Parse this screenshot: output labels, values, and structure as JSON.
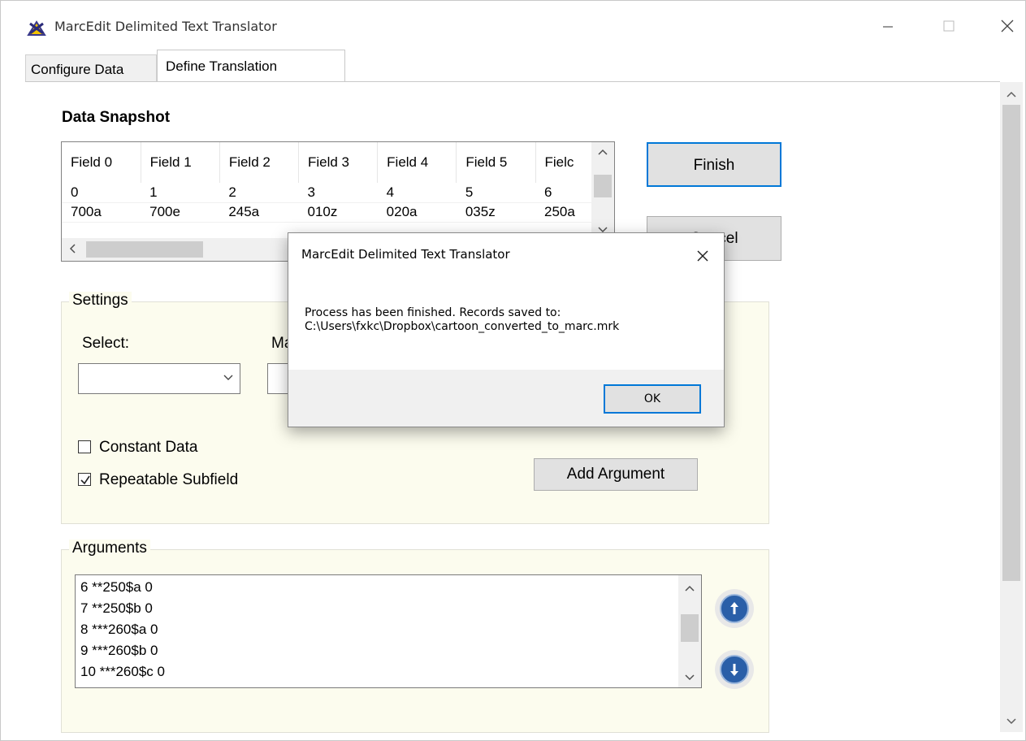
{
  "window": {
    "title": "MarcEdit Delimited Text Translator",
    "icons": {
      "app": "marcedit-app-icon",
      "minimize": "minimize-icon",
      "maximize": "maximize-icon",
      "close": "close-icon"
    }
  },
  "tabs": [
    {
      "label": "Configure Data",
      "active": false
    },
    {
      "label": "Define Translation",
      "active": true
    }
  ],
  "snapshot": {
    "title": "Data Snapshot",
    "headers": [
      "Field 0",
      "Field 1",
      "Field 2",
      "Field 3",
      "Field 4",
      "Field 5",
      "Fielc"
    ],
    "rows": [
      [
        "0",
        "1",
        "2",
        "3",
        "4",
        "5",
        "6"
      ],
      [
        "700a",
        "700e",
        "245a",
        "010z",
        "020a",
        "035z",
        "250a"
      ]
    ]
  },
  "buttons": {
    "finish": "Finish",
    "cancel": "Cancel",
    "add_argument": "Add Argument"
  },
  "settings": {
    "group_label": "Settings",
    "select_label": "Select:",
    "map_label": "Ma",
    "select_value": "",
    "constant_data": {
      "label": "Constant Data",
      "checked": false
    },
    "repeatable_subfield": {
      "label": "Repeatable Subfield",
      "checked": true
    }
  },
  "arguments": {
    "group_label": "Arguments",
    "items": [
      "6 **250$a 0",
      "7 **250$b 0",
      "8 ***260$a 0",
      "9 ***260$b 0",
      "10 ***260$c 0"
    ],
    "icons": {
      "up": "arrow-up-icon",
      "down": "arrow-down-icon"
    }
  },
  "dialog": {
    "title": "MarcEdit Delimited Text Translator",
    "message_line1": "Process has been finished.  Records saved to:",
    "message_line2": "C:\\Users\\fxkc\\Dropbox\\cartoon_converted_to_marc.mrk",
    "ok_label": "OK"
  },
  "colors": {
    "accent": "#0078d7",
    "group_bg": "#fcfcee",
    "nav_button": "#2a5fa8"
  }
}
